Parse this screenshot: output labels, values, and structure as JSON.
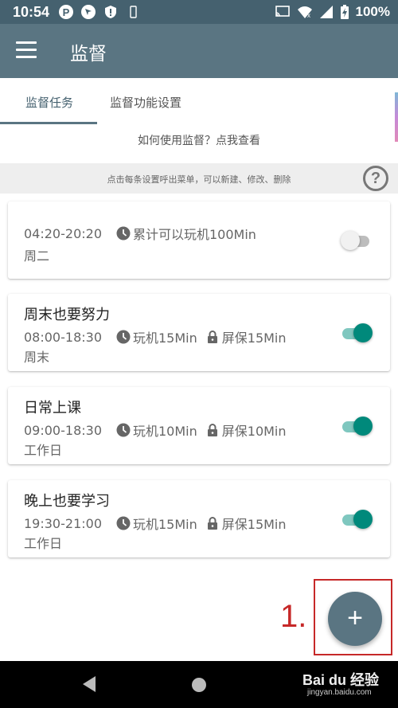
{
  "status_bar": {
    "time": "10:54",
    "battery": "100%",
    "left_icons": [
      "p-icon",
      "navigation-icon",
      "shield-icon",
      "phone-outline-icon"
    ],
    "right_icons": [
      "cast-icon",
      "wifi-icon",
      "signal-icon",
      "battery-charging-icon"
    ]
  },
  "app_bar": {
    "title": "监督",
    "menu_icon": "hamburger-menu-icon"
  },
  "tabs": [
    {
      "label": "监督任务",
      "active": true
    },
    {
      "label": "监督功能设置",
      "active": false
    }
  ],
  "howto_link": "如何使用监督？点我查看",
  "hint": {
    "text": "点击每条设置呼出菜单，可以新建、修改、删除",
    "icon": "help-icon"
  },
  "cards": [
    {
      "title": "",
      "time": "04:20-20:20",
      "play": "累计可以玩机100Min",
      "screensaver": "",
      "days": "周二",
      "enabled": false
    },
    {
      "title": "周末也要努力",
      "time": "08:00-18:30",
      "play": "玩机15Min",
      "screensaver": "屏保15Min",
      "days": "周末",
      "enabled": true
    },
    {
      "title": "日常上课",
      "time": "09:00-18:30",
      "play": "玩机10Min",
      "screensaver": "屏保10Min",
      "days": "工作日",
      "enabled": true
    },
    {
      "title": "晚上也要学习",
      "time": "19:30-21:00",
      "play": "玩机15Min",
      "screensaver": "屏保15Min",
      "days": "工作日",
      "enabled": true
    }
  ],
  "annotation": {
    "label": "1.",
    "color": "#c62828"
  },
  "fab": {
    "label": "+"
  },
  "watermark": {
    "brand": "Bai du 经验",
    "url": "jingyan.baidu.com"
  },
  "colors": {
    "primary": "#5a7582",
    "status_bar": "#45616f",
    "accent": "#00897b"
  }
}
